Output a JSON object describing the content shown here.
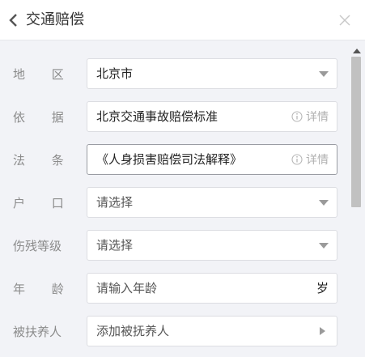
{
  "header": {
    "title": "交通赔偿"
  },
  "form": {
    "region": {
      "label": "地 区",
      "value": "北京市"
    },
    "basis": {
      "label": "依 据",
      "value": "北京交通事故赔偿标准",
      "detail_label": "详情"
    },
    "law": {
      "label": "法 条",
      "value": "《人身损害赔偿司法解释》",
      "detail_label": "详情"
    },
    "household": {
      "label": "户 口",
      "placeholder": "请选择"
    },
    "disability": {
      "label": "伤残等级",
      "placeholder": "请选择"
    },
    "age": {
      "label": "年 龄",
      "placeholder": "请输入年龄",
      "unit": "岁"
    },
    "dependents": {
      "label": "被扶养人",
      "placeholder": "添加被抚养人"
    }
  },
  "colors": {
    "label": "#8b8b8b",
    "border": "#dcdde2",
    "background": "#f2f3f7"
  }
}
